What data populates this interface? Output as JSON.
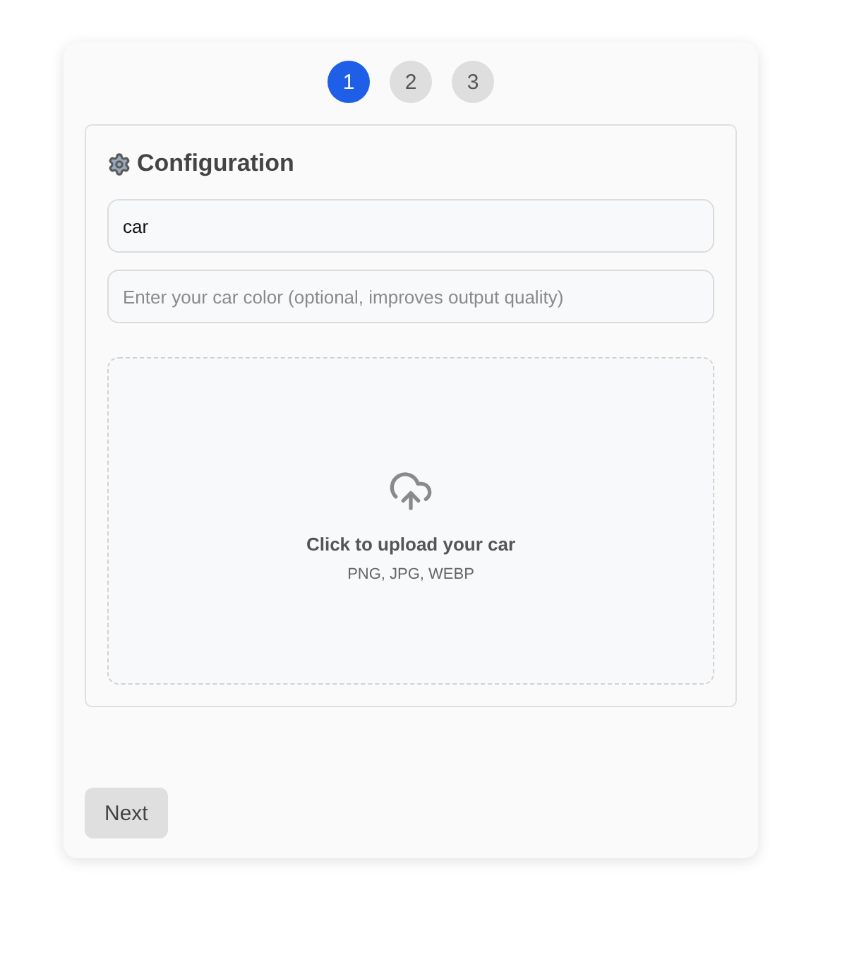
{
  "steps": [
    {
      "label": "1",
      "selected": true
    },
    {
      "label": "2",
      "selected": false
    },
    {
      "label": "3",
      "selected": false
    }
  ],
  "panel": {
    "title": "Configuration",
    "fields": [
      {
        "value": "car"
      },
      {
        "placeholder": "Enter your car color (optional, improves output quality)"
      }
    ],
    "upload": {
      "label": "Click to upload your car",
      "hint": "PNG, JPG, WEBP"
    }
  },
  "buttons": [
    {
      "label": "Next"
    }
  ]
}
